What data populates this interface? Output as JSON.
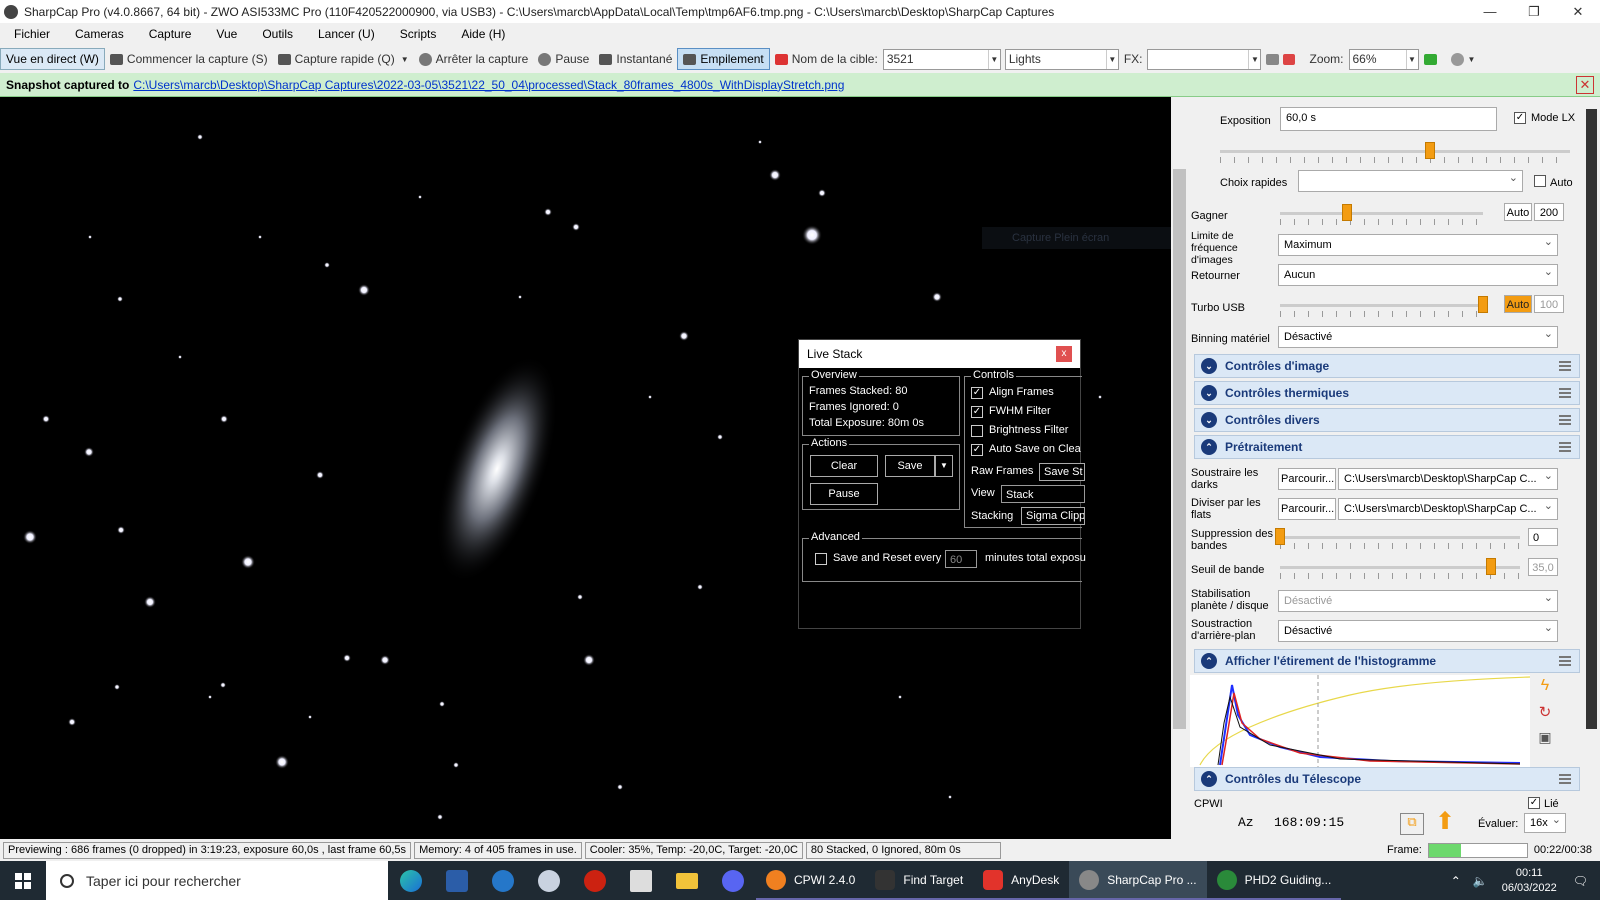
{
  "window": {
    "title": "SharpCap Pro (v4.0.8667, 64 bit) - ZWO ASI533MC Pro (110F420522000900, via USB3) - C:\\Users\\marcb\\AppData\\Local\\Temp\\tmp6AF6.tmp.png - C:\\Users\\marcb\\Desktop\\SharpCap Captures",
    "minimize": "—",
    "maximize": "❐",
    "close": "✕"
  },
  "menu": [
    "Fichier",
    "Cameras",
    "Capture",
    "Vue",
    "Outils",
    "Lancer (U)",
    "Scripts",
    "Aide (H)"
  ],
  "toolbar": {
    "live_view": "Vue en direct (W)",
    "start_capture": "Commencer la capture (S)",
    "quick_capture": "Capture rapide (Q)",
    "stop_capture": "Arrêter la capture",
    "pause": "Pause",
    "snapshot": "Instantané",
    "stacking": "Empilement",
    "target_label": "Nom de la cible:",
    "target_value": "3521",
    "frame_type": "Lights",
    "fx_label": "FX:",
    "fx_value": "",
    "zoom_label": "Zoom:",
    "zoom_value": "66%"
  },
  "notification": {
    "prefix": "Snapshot captured to",
    "path": "C:\\Users\\marcb\\Desktop\\SharpCap Captures\\2022-03-05\\3521\\22_50_04\\processed\\Stack_80frames_4800s_WithDisplayStretch.png",
    "close": "✕"
  },
  "overlay": {
    "fullscreen": "Capture Plein écran"
  },
  "live_stack": {
    "title": "Live Stack",
    "close": "x",
    "overview": {
      "legend": "Overview",
      "frames_stacked": "Frames Stacked: 80",
      "frames_ignored": "Frames Ignored:  0",
      "total_exposure": "Total Exposure:  80m 0s"
    },
    "actions": {
      "legend": "Actions",
      "clear": "Clear",
      "save": "Save",
      "pause": "Pause"
    },
    "controls": {
      "legend": "Controls",
      "align_frames": "Align Frames",
      "fwhm_filter": "FWHM Filter",
      "brightness_filter": "Brightness Filter",
      "auto_save": "Auto Save on Clea",
      "raw_frames_label": "Raw Frames",
      "raw_frames_btn": "Save St",
      "view_label": "View",
      "view_value": "Stack",
      "stacking_label": "Stacking",
      "stacking_value": "Sigma Clipp"
    },
    "advanced": {
      "legend": "Advanced",
      "save_reset": "Save and Reset every",
      "minutes_value": "60",
      "minutes_suffix": "minutes total exposu"
    }
  },
  "camera_panel": {
    "exposure_label": "Exposition",
    "exposure_value": "60,0 s",
    "mode_lx": "Mode LX",
    "exposure_slider": 0.6,
    "quick_choices_label": "Choix rapides",
    "quick_choices_value": "",
    "quick_auto": "Auto",
    "gain_label": "Gagner",
    "gain_auto": "Auto",
    "gain_value": "200",
    "gain_slider": 0.33,
    "frame_rate_label": "Limite de fréquence d'images",
    "frame_rate_value": "Maximum",
    "flip_label": "Retourner",
    "flip_value": "Aucun",
    "usb_turbo_label": "Turbo USB",
    "usb_auto": "Auto",
    "usb_value": "100",
    "usb_slider": 1.0,
    "binning_label": "Binning matériel",
    "binning_value": "Désactivé",
    "sections": [
      "Contrôles d'image",
      "Contrôles thermiques",
      "Contrôles divers",
      "Prétraitement"
    ],
    "darks_label": "Soustraire les darks",
    "darks_btn": "Parcourir...",
    "darks_path": "C:\\Users\\marcb\\Desktop\\SharpCap C...",
    "flats_label": "Diviser par les flats",
    "flats_btn": "Parcourir...",
    "flats_path": "C:\\Users\\marcb\\Desktop\\SharpCap C...",
    "banding_label": "Suppression des bandes",
    "banding_value": "0",
    "banding_slider": 0.0,
    "threshold_label": "Seuil de bande",
    "threshold_value": "35,0",
    "threshold_slider": 0.88,
    "stabilisation_label": "Stabilisation planète / disque",
    "stabilisation_value": "Désactivé",
    "background_label": "Soustraction d'arrière-plan",
    "background_value": "Désactivé",
    "histogram_section": "Afficher l'étirement de l'histogramme",
    "telescope_section": "Contrôles du Télescope",
    "telescope_name": "CPWI",
    "linked": "Lié",
    "az_label": "Az",
    "az_value": "168:09:15",
    "rate_label": "Évaluer:",
    "rate_value": "16x"
  },
  "status": {
    "preview": "Previewing : 686 frames (0 dropped) in 3:19:23, exposure 60,0s , last frame 60,5s",
    "memory": "Memory: 4 of 405 frames in use.",
    "cooler": "Cooler: 35%, Temp: -20,0C, Target: -20,0C",
    "stacked": "80 Stacked, 0 Ignored, 80m 0s",
    "frame_label": "Frame:",
    "frame_progress": 0.33,
    "frame_time": "00:22/00:38"
  },
  "taskbar": {
    "search_placeholder": "Taper ici pour rechercher",
    "apps": [
      "CPWI 2.4.0",
      "Find Target",
      "AnyDesk",
      "SharpCap Pro ...",
      "PHD2 Guiding..."
    ],
    "time": "00:11",
    "date": "06/03/2022"
  },
  "colors": {
    "accent_orange": "#f39c12",
    "section_blue": "#1a3a7a",
    "notif_green": "#cfeecf"
  }
}
